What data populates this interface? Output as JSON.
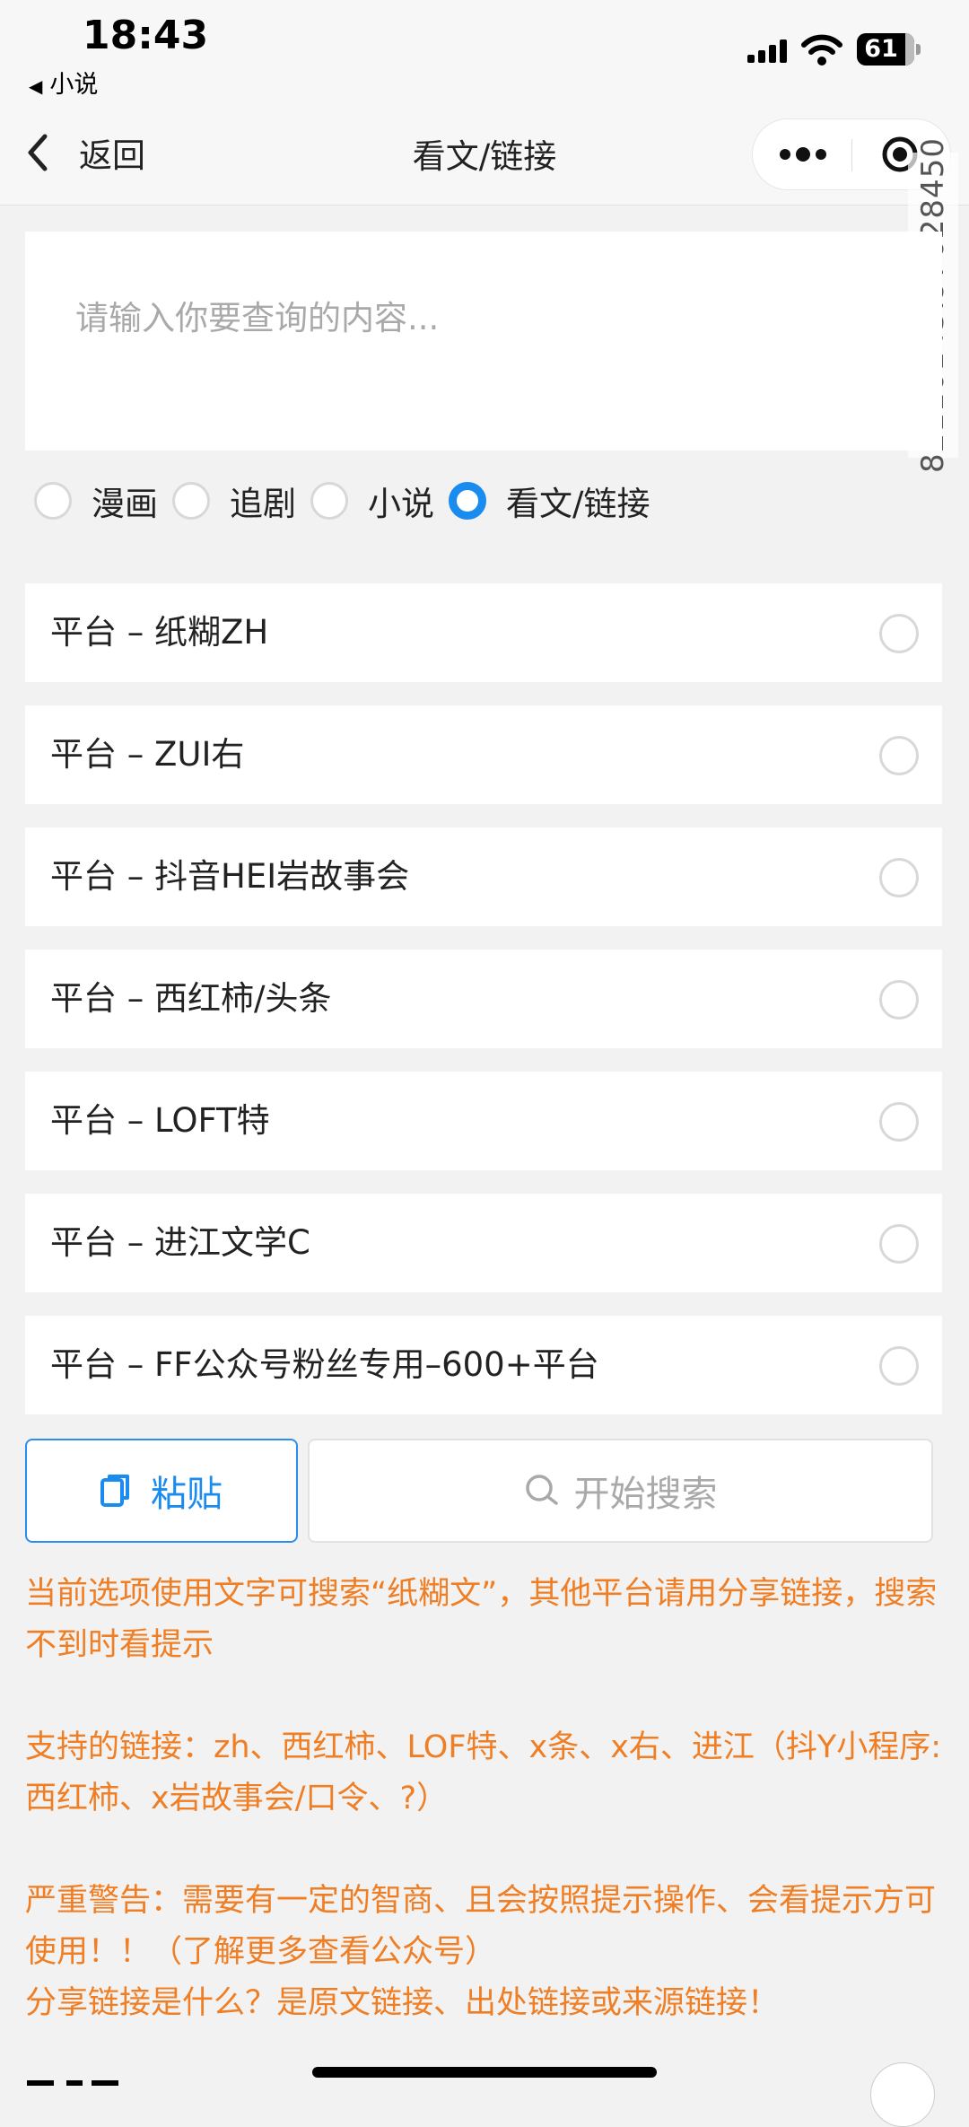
{
  "status": {
    "time": "18:43",
    "back_app": "小说",
    "battery": "61"
  },
  "nav": {
    "back_label": "返回",
    "title": "看文/链接"
  },
  "watermark": "82110145.97628450",
  "query": {
    "placeholder": "请输入你要查询的内容..."
  },
  "categories": [
    {
      "label": "漫画",
      "selected": false
    },
    {
      "label": "追剧",
      "selected": false
    },
    {
      "label": "小说",
      "selected": false
    },
    {
      "label": "看文/链接",
      "selected": true
    }
  ],
  "platforms": [
    "平台 – 纸糊ZH",
    "平台 – ZUI右",
    "平台 – 抖音HEI岩故事会",
    "平台 – 西红柿/头条",
    "平台 – LOFT特",
    "平台 – 进江文学C",
    "平台 – FF公众号粉丝专用–600+平台"
  ],
  "actions": {
    "paste_label": "粘贴",
    "search_label": "开始搜索"
  },
  "notes": {
    "line1": "当前选项使用文字可搜索“纸糊文”，其他平台请用分享链接，搜索不到时看提示",
    "line2": "支持的链接：zh、西红柿、LOF特、x条、x右、进江（抖Y小程序:西红柿、x岩故事会/口令、?）",
    "line3": "严重警告：需要有一定的智商、且会按照提示操作、会看提示方可使用！！（了解更多查看公众号）",
    "line4": "分享链接是什么？是原文链接、出处链接或来源链接！"
  },
  "colors": {
    "accent": "#1a8cf0",
    "warning": "#ef7e24",
    "background": "#f2f2f2"
  }
}
